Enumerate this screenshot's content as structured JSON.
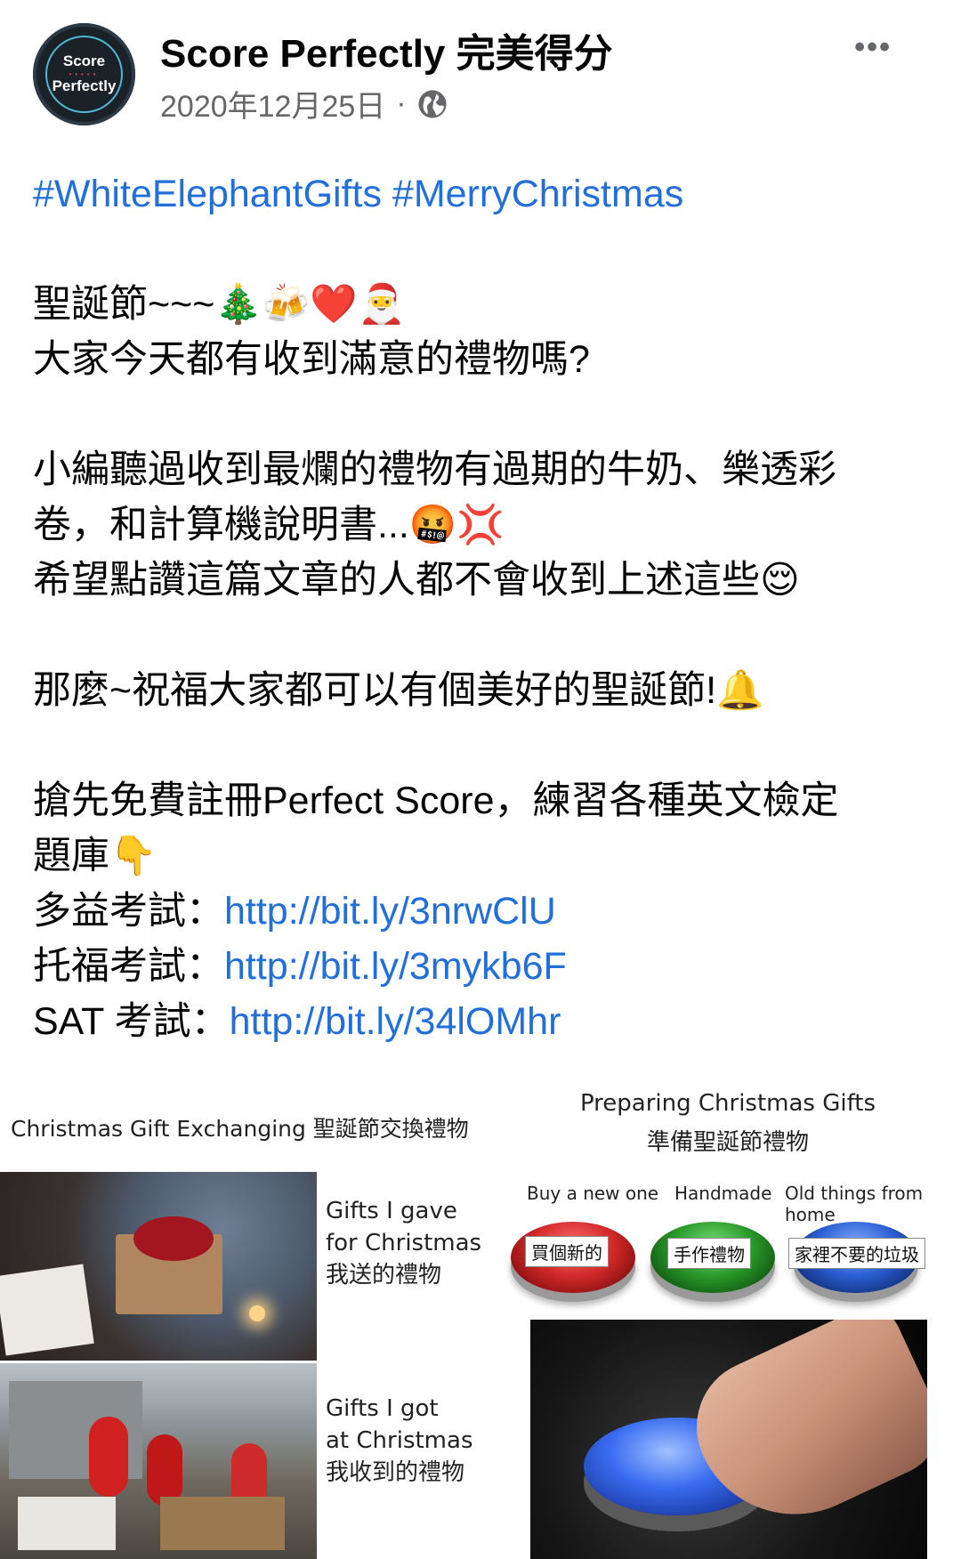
{
  "header": {
    "avatar_line1": "Score",
    "avatar_line2": "Perfectly",
    "page_name": "Score Perfectly 完美得分",
    "date": "2020年12月25日",
    "separator": "·",
    "more_label": "•••"
  },
  "post": {
    "hashtags": "#WhiteElephantGifts #MerryChristmas",
    "line1": "聖誕節~~~🎄🍻❤️🎅",
    "line2": "大家今天都有收到滿意的禮物嗎?",
    "line3": "小編聽過收到最爛的禮物有過期的牛奶、樂透彩",
    "line4": "卷，和計算機說明書...🤬💢",
    "line5": "希望點讚這篇文章的人都不會收到上述這些😌",
    "line6": "那麼~祝福大家都可以有個美好的聖誕節!🔔",
    "line7": "搶先免費註冊Perfect Score，練習各種英文檢定",
    "line8": "題庫👇",
    "links": [
      {
        "label": "多益考試：",
        "url": "http://bit.ly/3nrwClU"
      },
      {
        "label": "托福考試：",
        "url": "http://bit.ly/3mykb6F"
      },
      {
        "label": "SAT 考試：",
        "url": "http://bit.ly/34lOMhr"
      }
    ]
  },
  "meme_left": {
    "title": "Christmas Gift Exchanging 聖誕節交換禮物",
    "gave_en1": "Gifts I gave",
    "gave_en2": "for Christmas",
    "gave_zh": "我送的禮物",
    "got_en1": "Gifts I got",
    "got_en2": "at Christmas",
    "got_zh": "我收到的禮物"
  },
  "meme_right": {
    "title_en": "Preparing Christmas Gifts",
    "title_zh": "準備聖誕節禮物",
    "options": [
      {
        "caption": "Buy a new one",
        "label": "買個新的",
        "color": "#d42a2a"
      },
      {
        "caption": "Handmade",
        "label": "手作禮物",
        "color": "#2a9a2a"
      },
      {
        "caption": "Old things from home",
        "label": "家裡不要的垃圾",
        "color": "#2a5fd4"
      }
    ]
  },
  "colors": {
    "link": "#216fdb",
    "meta": "#65676b",
    "text": "#050505"
  }
}
